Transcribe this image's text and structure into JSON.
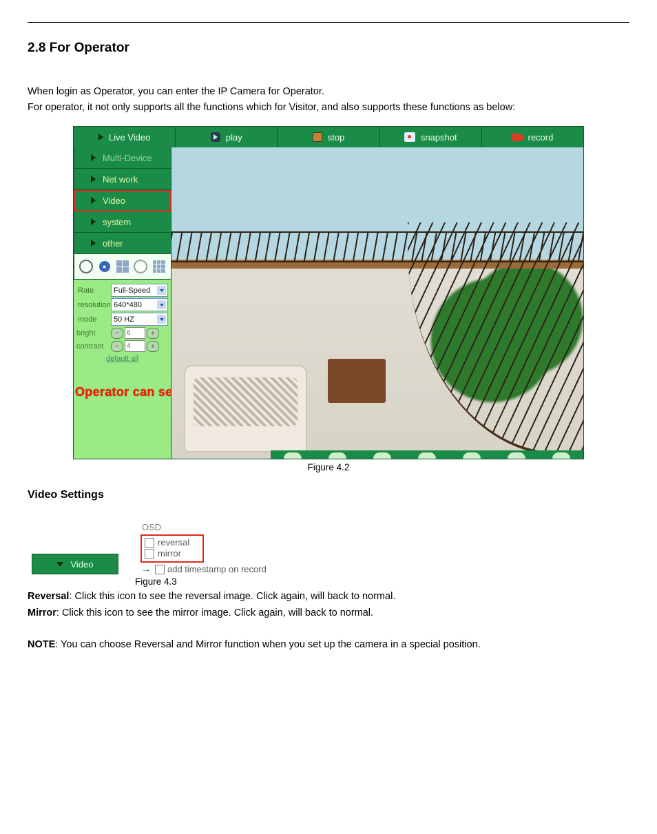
{
  "section": {
    "heading": "2.8 For Operator",
    "intro_line1": "When login as Operator, you can enter the IP Camera for Operator.",
    "intro_line2": "For operator, it not only supports all the functions which for Visitor, and also supports these functions as below:"
  },
  "fig42": {
    "toolbar": {
      "live_video": "Live Video",
      "play": "play",
      "stop": "stop",
      "snapshot": "snapshot",
      "record": "record"
    },
    "sidebar": {
      "multi_device": "Multi-Device",
      "network": "Net work",
      "video": "Video",
      "system": "system",
      "other": "other"
    },
    "controls": {
      "rate_label": "Rate",
      "rate_value": "Full-Speed",
      "resolution_label": "resolution",
      "resolution_value": "640*480",
      "mode_label": "mode",
      "mode_value": "50 HZ",
      "bright_label": "bright",
      "bright_value": "6",
      "contrast_label": "contrast",
      "contrast_value": "4",
      "default_all": "default all"
    },
    "annotation": "Operator can set the parameters",
    "caption": "Figure 4.2"
  },
  "video_settings": {
    "heading": "Video Settings",
    "video_button": "Video",
    "osd_title": "OSD",
    "reversal": "reversal",
    "mirror": "mirror",
    "timestamp": "add timestamp on record",
    "caption": "Figure 4.3",
    "reversal_label": "Reversal",
    "reversal_desc": ": Click this icon to see the reversal image. Click again, will back to normal.",
    "mirror_label": "Mirror",
    "mirror_desc": ": Click this icon to see the mirror image. Click again, will back to normal.",
    "note_label": "NOTE",
    "note_desc": ": You can choose Reversal and Mirror function when you set up the camera in a special position."
  }
}
